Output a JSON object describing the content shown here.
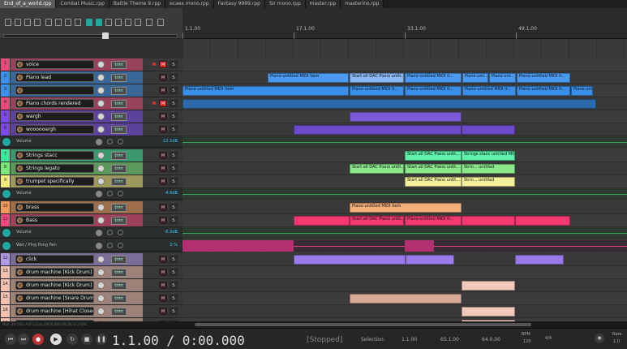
{
  "tabs": [
    "End_of_a_world.rpp",
    "Combat Music.rpp",
    "Battle Theme 9.rpp",
    "ecaex mono.rpp",
    "Fantasy 9999.rpp",
    "Sir mono.rpp",
    "master.rpp",
    "masterino.rpp"
  ],
  "ruler": {
    "marks": [
      "1.1.00",
      "17.1.00",
      "33.1.00",
      "49.1.00"
    ]
  },
  "tracks": [
    {
      "num": "1",
      "name": "voice",
      "color": "#e84a7a",
      "mute": true,
      "rec": true
    },
    {
      "num": "2",
      "name": "Piano lead",
      "color": "#3a8fe8",
      "mute": false,
      "rec": false
    },
    {
      "num": "3",
      "name": "",
      "color": "#3a8fe8",
      "mute": false,
      "rec": false
    },
    {
      "num": "4",
      "name": "Piano chords rendered",
      "color": "#e84a7a",
      "mute": true,
      "rec": true
    },
    {
      "num": "5",
      "name": "wargh",
      "color": "#7a4ae8",
      "mute": false,
      "rec": false
    },
    {
      "num": "6",
      "name": "woooooargh",
      "color": "#7a4ae8",
      "mute": false,
      "rec": false
    },
    {
      "num": "7",
      "name": "Strings stacc",
      "color": "#3ee89a",
      "mute": false,
      "rec": false
    },
    {
      "num": "8",
      "name": "Strings legato",
      "color": "#7ae87a",
      "mute": false,
      "rec": false
    },
    {
      "num": "9",
      "name": "trumpet specifically",
      "color": "#f0ea7a",
      "mute": false,
      "rec": false
    },
    {
      "num": "10",
      "name": "brass",
      "color": "#f29a5a",
      "mute": false,
      "rec": false
    },
    {
      "num": "11",
      "name": "Bass",
      "color": "#f24a7a",
      "mute": false,
      "rec": false
    },
    {
      "num": "12",
      "name": "click",
      "color": "#b09ae8",
      "mute": false,
      "rec": false
    },
    {
      "num": "13",
      "name": "drum machine [Kick Drum]",
      "color": "#f0c0b0",
      "mute": false,
      "rec": false
    },
    {
      "num": "14",
      "name": "drum machine [Kick Drum]",
      "color": "#f0c0b0",
      "mute": false,
      "rec": false
    },
    {
      "num": "15",
      "name": "drum machine [Snare Drum]",
      "color": "#f0c0b0",
      "mute": false,
      "rec": false
    },
    {
      "num": "16",
      "name": "drum machine [Hihat Closed]",
      "color": "#f0c0b0",
      "mute": false,
      "rec": false
    },
    {
      "num": "17",
      "name": "drum machine",
      "color": "#f0c0b0",
      "mute": false,
      "rec": false
    }
  ],
  "envelopes": [
    {
      "label": "Volume",
      "value": "-12.1dB"
    },
    {
      "label": "Volume",
      "value": "-4.6dB"
    },
    {
      "label": "Volume",
      "value": "-6.0dB"
    },
    {
      "label": "Wet / Ping Pong Pan",
      "value": "0 %"
    }
  ],
  "io_label": "trim",
  "mute_label": "M",
  "solo_label": "S",
  "items": {
    "piano_midi": "Piano-untitled MIDI item",
    "start_all": "Start all DAC Piano untit...",
    "piano_untitled": "Piano-untitled MIDI it...",
    "piano_short": "Piano unt...",
    "strings_stacc": "Strings stacc untitled MIDI item",
    "strings_short": "Strin... untitled"
  },
  "transport": {
    "time": "1.1.00 / 0:00.000",
    "state": "[Stopped]",
    "selection_label": "Selection:",
    "sel_start": "1.1.00",
    "sel_end": "65.1.00",
    "sel_len": "64.0.00",
    "bpm_label": "BPM",
    "bpm": "120",
    "sig_label": "4/4",
    "rate_label": "Rate",
    "rate": "1.0"
  },
  "status_strip": "Mod: 80 OSS/ AOFS Data 39/00:48/0sRC/RCO-2/stRC"
}
